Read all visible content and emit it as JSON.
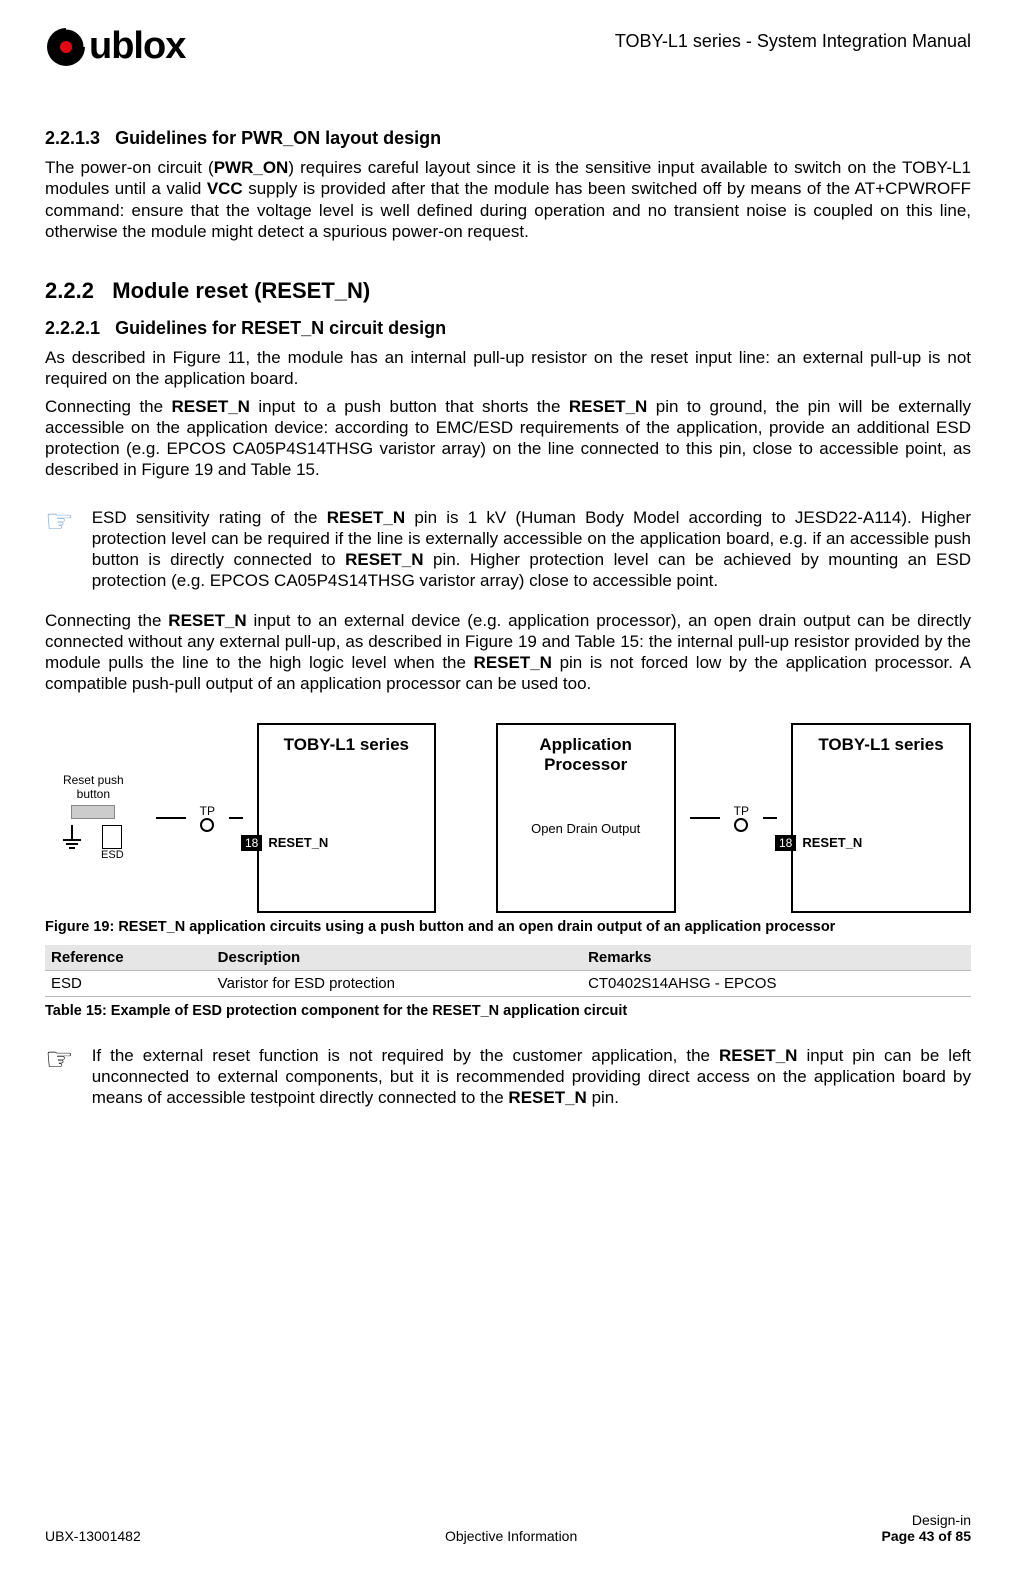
{
  "header": {
    "brand_prefix": "u",
    "brand_suffix": "blox",
    "doc_title": "TOBY-L1 series - System Integration Manual"
  },
  "s1": {
    "num": "2.2.1.3",
    "title": "Guidelines for PWR_ON layout design",
    "p1_a": "The power-on circuit (",
    "p1_b": "PWR_ON",
    "p1_c": ") requires careful layout since it is the sensitive input available to switch on the TOBY-L1 modules until a valid ",
    "p1_d": "VCC",
    "p1_e": " supply is provided after that the module has been switched off by means of the AT+CPWROFF command: ensure that the voltage level is well defined during operation and no transient noise is coupled on this line, otherwise the module might detect a spurious power-on request."
  },
  "s2": {
    "num": "2.2.2",
    "title": "Module reset (RESET_N)"
  },
  "s3": {
    "num": "2.2.2.1",
    "title": "Guidelines for RESET_N circuit design",
    "p1": "As described in Figure 11, the module has an internal pull-up resistor on the reset input line: an external pull-up is not required on the application board.",
    "p2_a": "Connecting the ",
    "p2_b": "RESET_N",
    "p2_c": " input to a push button that shorts the ",
    "p2_d": "RESET_N",
    "p2_e": " pin to ground, the pin will be externally accessible on the application device: according to EMC/ESD requirements of the application, provide an additional ESD protection (e.g. EPCOS CA05P4S14THSG varistor array) on the line connected to this pin, close to accessible point, as described in Figure 19 and Table 15."
  },
  "note1": {
    "a": "ESD sensitivity rating of the ",
    "b": "RESET_N",
    "c": " pin is 1 kV (Human Body Model according to JESD22-A114). Higher protection level can be required if the line is externally accessible on the application board, e.g. if an accessible push button is directly connected to ",
    "d": "RESET_N",
    "e": " pin. Higher protection level can be achieved by mounting an ESD protection (e.g. EPCOS CA05P4S14THSG varistor array) close to accessible point."
  },
  "p_after_note": {
    "a": "Connecting the ",
    "b": "RESET_N",
    "c": " input to an external device (e.g. application processor), an open drain output can be directly connected without any external pull-up, as described in Figure 19 and Table 15: the internal pull-up resistor provided by the module pulls the line to the high logic level when the ",
    "d": "RESET_N",
    "e": " pin is not forced low by the application processor. A compatible push-pull output of an application processor can be used too."
  },
  "figure": {
    "left_module": "TOBY-L1 series",
    "right_module": "TOBY-L1 series",
    "app_proc": "Application Processor",
    "reset_btn": "Reset push button",
    "esd": "ESD",
    "tp": "TP",
    "pin_num": "18",
    "pin_lbl": "RESET_N",
    "open_drain": "Open Drain Output",
    "caption": "Figure 19: RESET_N application circuits using a push button and an open drain output of an application processor"
  },
  "table": {
    "h1": "Reference",
    "h2": "Description",
    "h3": "Remarks",
    "r1c1": "ESD",
    "r1c2": "Varistor for ESD protection",
    "r1c3": "CT0402S14AHSG - EPCOS",
    "caption": "Table 15: Example of ESD protection component for the RESET_N application circuit"
  },
  "note2": {
    "a": "If the external reset function is not required by the customer application, the ",
    "b": "RESET_N",
    "c": " input pin can be left unconnected to external components, but it is recommended providing direct access on the application board by means of accessible testpoint directly connected to the ",
    "d": "RESET_N",
    "e": " pin."
  },
  "footer": {
    "left": "UBX-13001482",
    "center": "Objective Information",
    "right_top": "Design-in",
    "right_bottom": "Page 43 of 85"
  }
}
